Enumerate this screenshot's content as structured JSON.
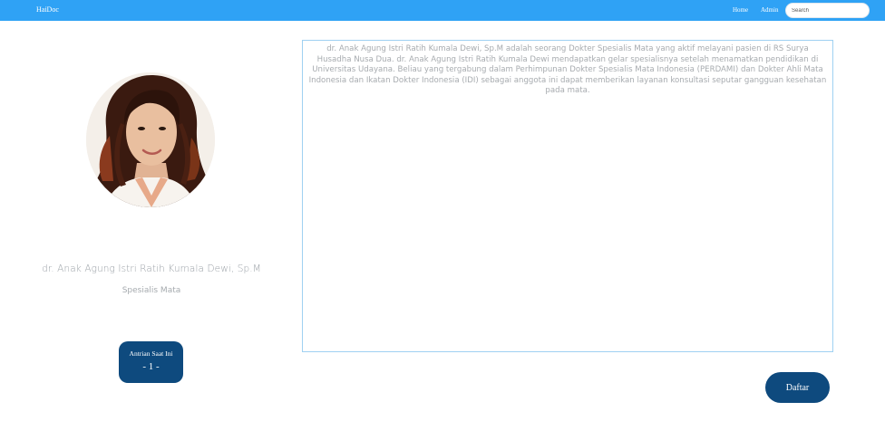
{
  "navbar": {
    "brand": "HaiDoc",
    "links": [
      {
        "label": "Home"
      },
      {
        "label": "Admin"
      }
    ],
    "search": {
      "placeholder": "Search",
      "value": ""
    }
  },
  "doctor": {
    "name": "dr. Anak Agung Istri Ratih Kumala Dewi, Sp.M",
    "specialty": "Spesialis Mata",
    "bio": "dr. Anak Agung Istri Ratih Kumala Dewi, Sp.M adalah seorang Dokter Spesialis Mata yang aktif melayani pasien di RS Surya Husadha Nusa Dua. dr. Anak Agung Istri Ratih Kumala Dewi mendapatkan gelar spesialisnya setelah menamatkan pendidikan di Universitas Udayana. Beliau yang tergabung dalam Perhimpunan Dokter Spesialis Mata Indonesia (PERDAMI) dan Dokter Ahli Mata Indonesia dan Ikatan Dokter Indonesia (IDI) sebagai anggota ini dapat memberikan layanan konsultasi seputar gangguan kesehatan pada mata."
  },
  "queue": {
    "label": "Antrian Saat Ini",
    "number": "- 1 -"
  },
  "actions": {
    "register_label": "Daftar"
  },
  "colors": {
    "navbar": "#2fa2f5",
    "primary_button": "#0e4a7e",
    "bio_border": "#9fd1f2"
  }
}
